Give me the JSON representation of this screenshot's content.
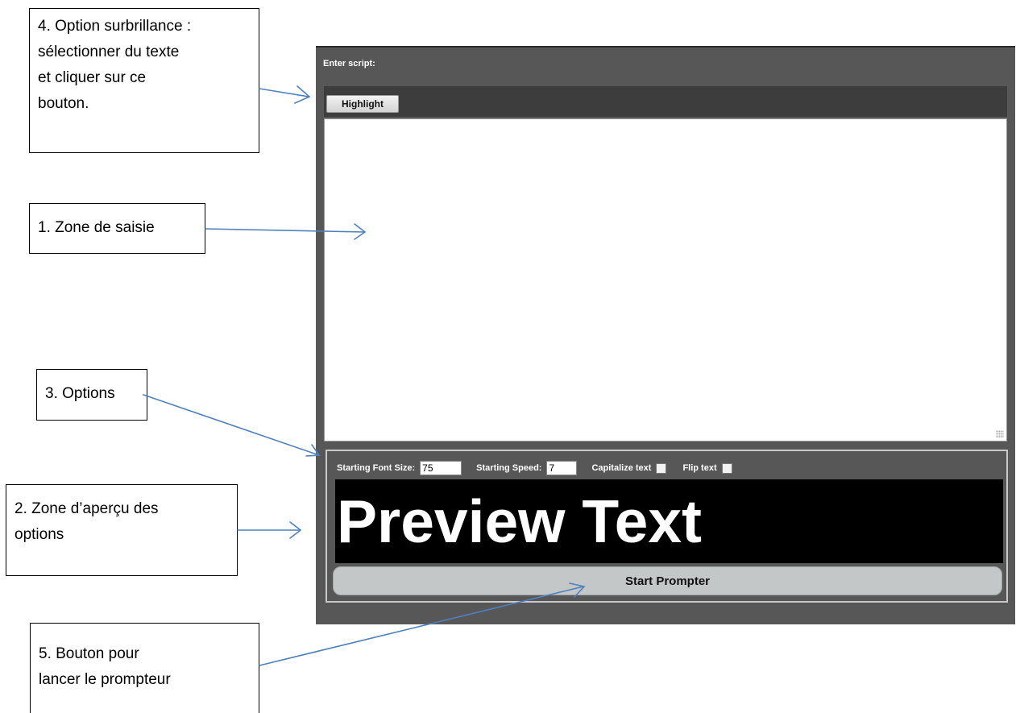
{
  "app": {
    "script_label": "Enter script:",
    "highlight_button": "Highlight",
    "editor_value": "",
    "options": {
      "font_size_label": "Starting Font Size:",
      "font_size_value": "75",
      "speed_label": "Starting Speed:",
      "speed_value": "7",
      "capitalize_label": "Capitalize text",
      "flip_label": "Flip text"
    },
    "preview_text": "Preview Text",
    "start_button": "Start Prompter"
  },
  "annotations": {
    "highlight_note": "4. Option surbrillance :\nsélectionner du texte\net cliquer sur ce\nbouton.",
    "input_zone_note": "1. Zone de saisie",
    "options_note": "3. Options",
    "preview_note": "2. Zone d’aperçu des\noptions",
    "start_note": "5. Bouton pour\nlancer le prompteur"
  },
  "colors": {
    "arrow": "#4f81bd",
    "panel_bg": "#575757",
    "preview_bg": "#000000",
    "start_button_bg": "#c3c7c7"
  }
}
